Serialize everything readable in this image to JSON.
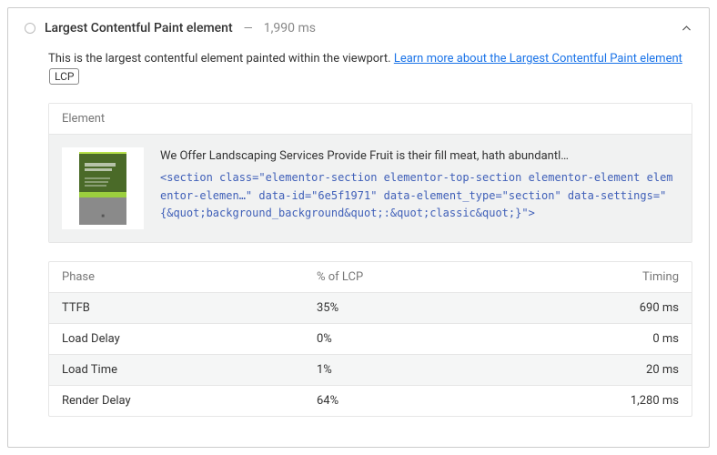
{
  "header": {
    "title": "Largest Contentful Paint element",
    "dash": "—",
    "timing": "1,990 ms"
  },
  "description": {
    "text": "This is the largest contentful element painted within the viewport. ",
    "link": "Learn more about the Largest Contentful Paint element",
    "badge": "LCP"
  },
  "element": {
    "header_label": "Element",
    "title": "We Offer Landscaping Services Provide Fruit is their fill meat, hath abundantl…",
    "code": "<section class=\"elementor-section elementor-top-section elementor-element elementor-elemen…\" data-id=\"6e5f1971\" data-element_type=\"section\" data-settings=\"{&quot;background_background&quot;:&quot;classic&quot;}\">"
  },
  "phases": {
    "headers": {
      "phase": "Phase",
      "pct": "% of LCP",
      "timing": "Timing"
    },
    "rows": [
      {
        "phase": "TTFB",
        "pct": "35%",
        "timing": "690 ms"
      },
      {
        "phase": "Load Delay",
        "pct": "0%",
        "timing": "0 ms"
      },
      {
        "phase": "Load Time",
        "pct": "1%",
        "timing": "20 ms"
      },
      {
        "phase": "Render Delay",
        "pct": "64%",
        "timing": "1,280 ms"
      }
    ]
  }
}
